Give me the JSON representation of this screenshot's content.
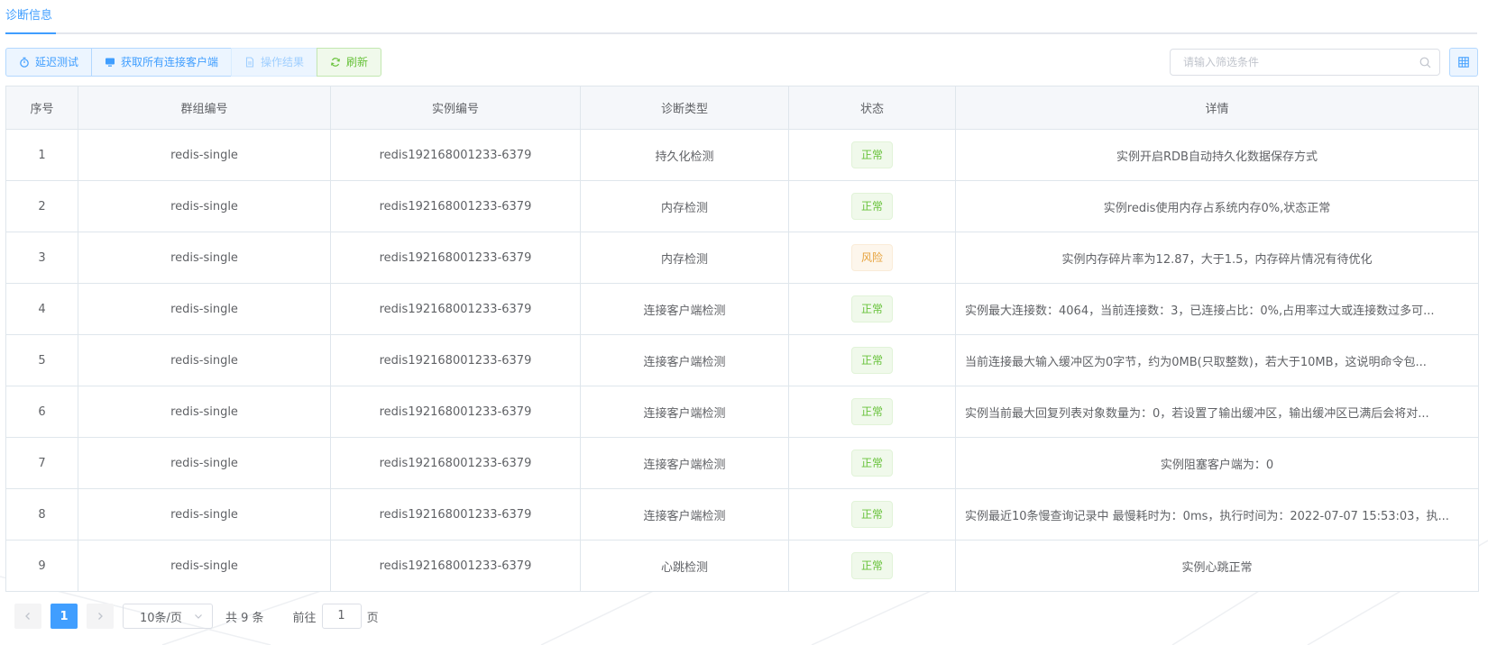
{
  "tabs": [
    {
      "label": "诊断信息"
    }
  ],
  "toolbar": {
    "latency_test": "延迟测试",
    "get_clients": "获取所有连接客户端",
    "op_result": "操作结果",
    "refresh": "刷新"
  },
  "search": {
    "placeholder": "请输入筛选条件",
    "value": ""
  },
  "table": {
    "columns": [
      "序号",
      "群组编号",
      "实例编号",
      "诊断类型",
      "状态",
      "详情"
    ],
    "rows": [
      {
        "no": "1",
        "group": "redis-single",
        "instance": "redis192168001233-6379",
        "type": "持久化检测",
        "status": "正常",
        "detail": "实例开启RDB自动持久化数据保存方式"
      },
      {
        "no": "2",
        "group": "redis-single",
        "instance": "redis192168001233-6379",
        "type": "内存检测",
        "status": "正常",
        "detail": "实例redis使用内存占系统内存0%,状态正常"
      },
      {
        "no": "3",
        "group": "redis-single",
        "instance": "redis192168001233-6379",
        "type": "内存检测",
        "status": "风险",
        "detail": "实例内存碎片率为12.87，大于1.5，内存碎片情况有待优化"
      },
      {
        "no": "4",
        "group": "redis-single",
        "instance": "redis192168001233-6379",
        "type": "连接客户端检测",
        "status": "正常",
        "detail": "实例最大连接数：4064，当前连接数：3，已连接占比：0%,占用率过大或连接数过多可..."
      },
      {
        "no": "5",
        "group": "redis-single",
        "instance": "redis192168001233-6379",
        "type": "连接客户端检测",
        "status": "正常",
        "detail": "当前连接最大输入缓冲区为0字节，约为0MB(只取整数)，若大于10MB，这说明命令包..."
      },
      {
        "no": "6",
        "group": "redis-single",
        "instance": "redis192168001233-6379",
        "type": "连接客户端检测",
        "status": "正常",
        "detail": "实例当前最大回复列表对象数量为：0，若设置了输出缓冲区，输出缓冲区已满后会将对..."
      },
      {
        "no": "7",
        "group": "redis-single",
        "instance": "redis192168001233-6379",
        "type": "连接客户端检测",
        "status": "正常",
        "detail": "实例阻塞客户端为：0"
      },
      {
        "no": "8",
        "group": "redis-single",
        "instance": "redis192168001233-6379",
        "type": "连接客户端检测",
        "status": "正常",
        "detail": "实例最近10条慢查询记录中 最慢耗时为：0ms，执行时间为：2022-07-07 15:53:03，执..."
      },
      {
        "no": "9",
        "group": "redis-single",
        "instance": "redis192168001233-6379",
        "type": "心跳检测",
        "status": "正常",
        "detail": "实例心跳正常"
      }
    ]
  },
  "pagination": {
    "current_page": "1",
    "page_size": "10条/页",
    "total": "共 9 条",
    "goto_prefix": "前往",
    "goto_value": "1",
    "goto_suffix": "页"
  },
  "colors": {
    "primary": "#409eff",
    "success": "#67c23a",
    "warning": "#e6a23c"
  },
  "icons": [
    "stopwatch-icon",
    "monitor-icon",
    "document-icon",
    "refresh-icon",
    "search-icon",
    "grid-icon",
    "chevron-left-icon",
    "chevron-right-icon",
    "chevron-down-icon"
  ]
}
